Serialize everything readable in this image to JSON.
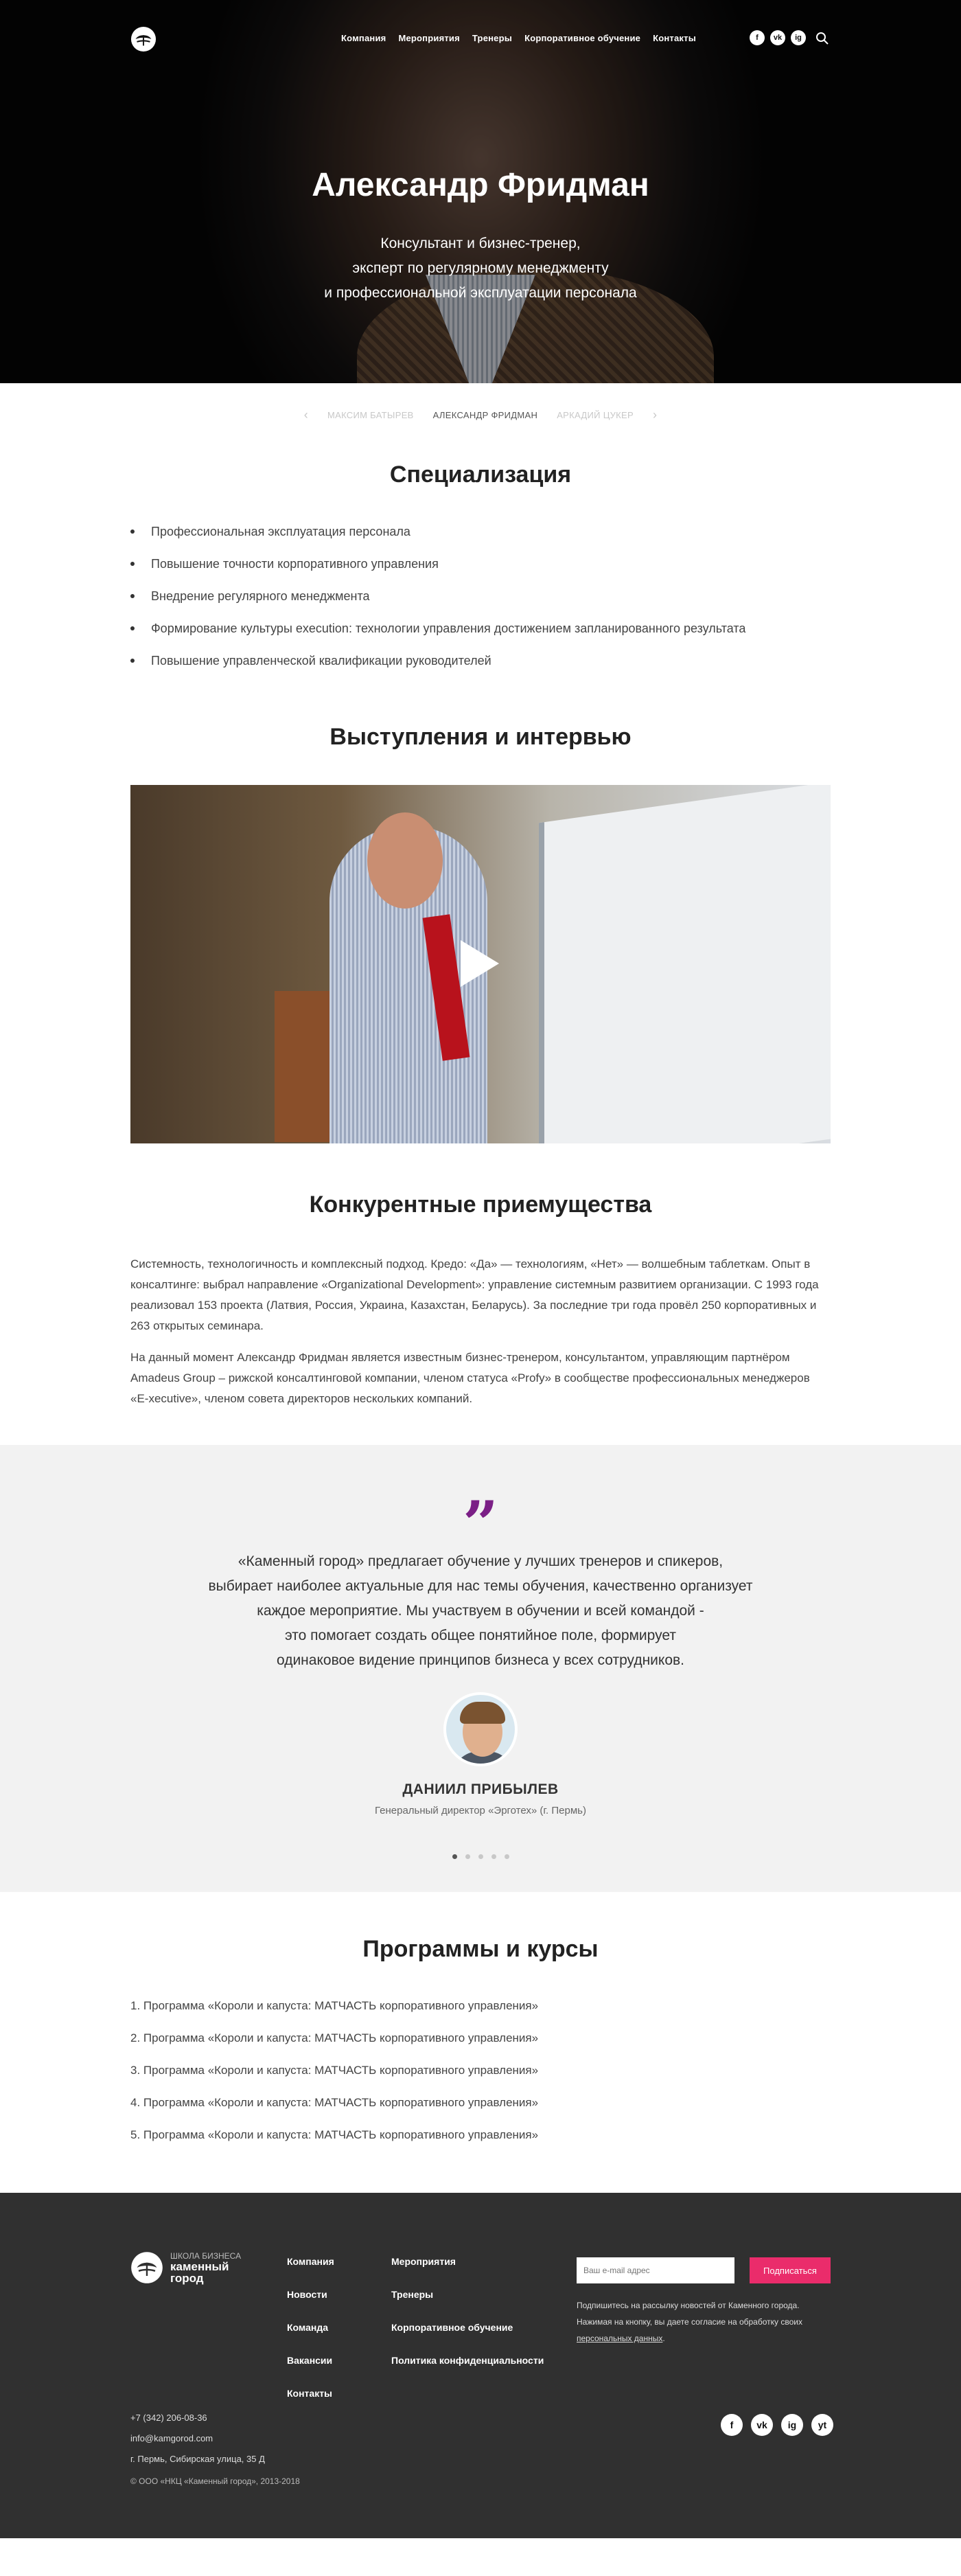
{
  "header": {
    "nav": [
      "Компания",
      "Мероприятия",
      "Тренеры",
      "Корпоративное обучение",
      "Контакты"
    ],
    "social": [
      "f",
      "vk",
      "ig"
    ]
  },
  "hero": {
    "title": "Александр Фридман",
    "subtitle_lines": [
      "Консультант и бизнес-тренер,",
      "эксперт по регулярному менеджменту",
      "и профессиональной эксплуатации персонала"
    ]
  },
  "pager": {
    "prev_arrow": "‹",
    "prev": "Максим Батырев",
    "current": "Александр Фридман",
    "next": "Аркадий Цукер",
    "next_arrow": "›"
  },
  "specialization": {
    "title": "Специализация",
    "items": [
      "Профессиональная эксплуатация персонала",
      "Повышение точности корпоративного управления",
      "Внедрение регулярного менеджмента",
      "Формирование культуры execution: технологии управления достижением запланированного результата",
      "Повышение управленческой квалификации руководителей"
    ]
  },
  "speeches": {
    "title": "Выступления и интервью"
  },
  "advantages": {
    "title": "Конкурентные приемущества",
    "paragraphs": [
      "Системность, технологичность и комплексный подход. Кредо: «Да» — технологиям, «Нет» — волшебным таблеткам. Опыт в консалтинге: выбрал направление «Organizational Development»: управление системным развитием организации. С 1993 года реализовал 153 проекта (Латвия, Россия, Украина, Казахстан, Беларусь). За последние три года провёл 250 корпоративных и 263 открытых семинара.",
      "На данный момент Александр Фридман является известным бизнес-тренером, консультантом, управляющим партнёром Amadeus Group – рижской консалтинговой компании, членом статуса «Profy» в сообществе профессиональных менеджеров «E-xecutive», членом совета директоров нескольких компаний."
    ]
  },
  "testimonial": {
    "quote_mark": "”",
    "lines": [
      "«Каменный город» предлагает обучение у лучших тренеров и спикеров,",
      "выбирает наиболее актуальные для нас темы обучения, качественно организует",
      "каждое мероприятие. Мы участвуем в обучении и всей командой -",
      "это помогает создать общее понятийное поле, формирует",
      "одинаковое видение принципов бизнеса у всех сотрудников."
    ],
    "name": "ДАНИИЛ ПРИБЫЛЕВ",
    "role": "Генеральный директор «Эрготех» (г. Пермь)"
  },
  "programs": {
    "title": "Программы и курсы",
    "items": [
      "1. Программа «Короли и капуста: МАТЧАСТЬ корпоративного управления»",
      "2. Программа «Короли и капуста: МАТЧАСТЬ корпоративного управления»",
      "3. Программа «Короли и капуста: МАТЧАСТЬ корпоративного управления»",
      "4. Программа «Короли и капуста: МАТЧАСТЬ корпоративного управления»",
      "5. Программа «Короли и капуста: МАТЧАСТЬ корпоративного управления»"
    ]
  },
  "footer": {
    "logo_top": "Школа бизнеса",
    "logo_line1": "каменный",
    "logo_line2": "город",
    "col1": [
      "Компания",
      "Новости",
      "Команда",
      "Вакансии",
      "Контакты"
    ],
    "col2": [
      "Мероприятия",
      "Тренеры",
      "Корпоративное обучение",
      "Политика конфиденциальности"
    ],
    "subscribe_placeholder": "Ваш e-mail адрес",
    "subscribe_button": "Подписаться",
    "subscribe_note": "Подпишитесь на рассылку новостей от Каменного города. Нажимая на кнопку, вы даете согласие на обработку своих",
    "subscribe_link": "персональных данных",
    "phone": "+7 (342) 206-08-36",
    "email": "info@kamgorod.com",
    "address": "г. Пермь, Сибирская улица, 35 Д",
    "copyright": "© ООО «НКЦ «Каменный город», 2013-2018",
    "social": [
      "f",
      "vk",
      "ig",
      "yt"
    ]
  },
  "colors": {
    "accent": "#7b1f86",
    "button": "#ea2c6b",
    "footer_bg": "#303030"
  }
}
